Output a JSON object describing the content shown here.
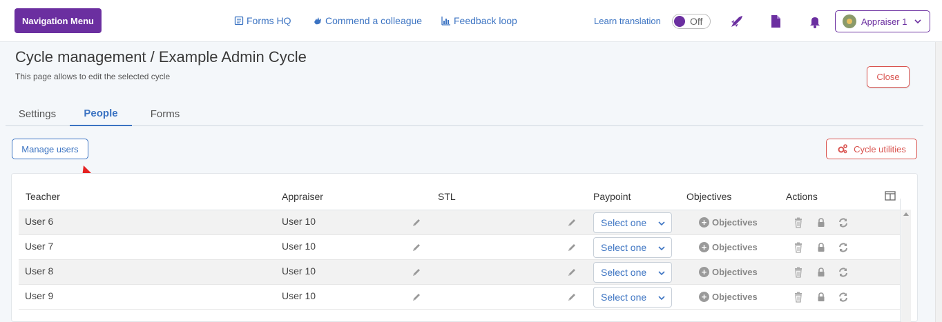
{
  "header": {
    "nav_menu_label": "Navigation Menu",
    "links": [
      {
        "label": "Forms HQ",
        "icon": "forms-icon"
      },
      {
        "label": "Commend a colleague",
        "icon": "hand-icon"
      },
      {
        "label": "Feedback loop",
        "icon": "bar-chart-icon"
      }
    ],
    "learn_translation_label": "Learn translation",
    "toggle_label": "Off",
    "user_menu_label": "Appraiser 1",
    "accent_color": "#6b2fa0"
  },
  "page": {
    "title": "Cycle management / Example Admin Cycle",
    "subtitle": "This page allows to edit the selected cycle",
    "close_label": "Close"
  },
  "tabs": [
    {
      "label": "Settings",
      "active": false
    },
    {
      "label": "People",
      "active": true
    },
    {
      "label": "Forms",
      "active": false
    }
  ],
  "toolbar": {
    "manage_users_label": "Manage users",
    "cycle_utilities_label": "Cycle utilities"
  },
  "table": {
    "columns": [
      "Teacher",
      "Appraiser",
      "STL",
      "Paypoint",
      "Objectives",
      "Actions"
    ],
    "rows": [
      {
        "teacher": "User 6",
        "appraiser": "User 10",
        "paypoint": "Select one",
        "objectives": "Objectives"
      },
      {
        "teacher": "User 7",
        "appraiser": "User 10",
        "paypoint": "Select one",
        "objectives": "Objectives"
      },
      {
        "teacher": "User 8",
        "appraiser": "User 10",
        "paypoint": "Select one",
        "objectives": "Objectives"
      },
      {
        "teacher": "User 9",
        "appraiser": "User 10",
        "paypoint": "Select one",
        "objectives": "Objectives"
      }
    ]
  }
}
